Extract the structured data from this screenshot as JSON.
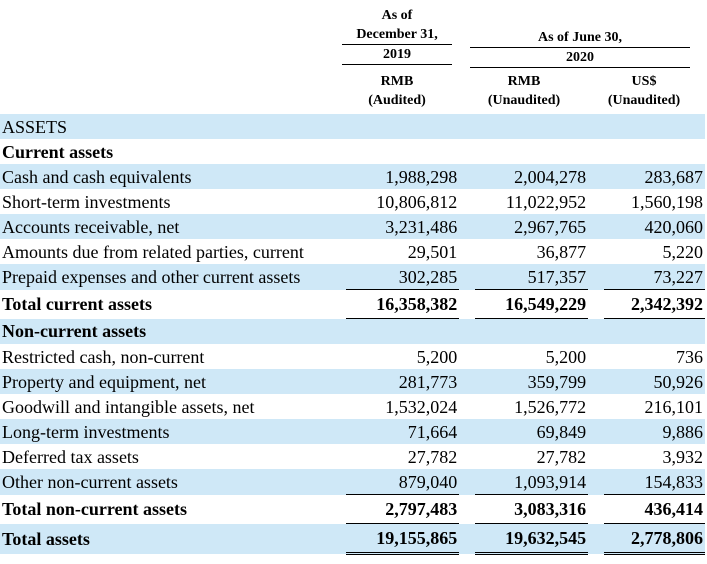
{
  "header": {
    "dec_line1": "As of",
    "dec_line2": "December 31,",
    "dec_year": "2019",
    "jun_label": "As of June 30,",
    "jun_year": "2020",
    "col1_currency": "RMB",
    "col1_status": "(Audited)",
    "col2_currency": "RMB",
    "col2_status": "(Unaudited)",
    "col3_currency": "US$",
    "col3_status": "(Unaudited)"
  },
  "rows": [
    {
      "label": "ASSETS",
      "v1": "",
      "v2": "",
      "v3": ""
    },
    {
      "label": "Current assets",
      "v1": "",
      "v2": "",
      "v3": ""
    },
    {
      "label": "Cash and cash equivalents",
      "v1": "1,988,298",
      "v2": "2,004,278",
      "v3": "283,687"
    },
    {
      "label": "Short-term investments",
      "v1": "10,806,812",
      "v2": "11,022,952",
      "v3": "1,560,198"
    },
    {
      "label": "Accounts receivable, net",
      "v1": "3,231,486",
      "v2": "2,967,765",
      "v3": "420,060"
    },
    {
      "label": "Amounts due from related parties, current",
      "v1": "29,501",
      "v2": "36,877",
      "v3": "5,220"
    },
    {
      "label": "Prepaid expenses and other current assets",
      "v1": "302,285",
      "v2": "517,357",
      "v3": "73,227"
    },
    {
      "label": "Total current assets",
      "v1": "16,358,382",
      "v2": "16,549,229",
      "v3": "2,342,392"
    },
    {
      "label": "Non-current assets",
      "v1": "",
      "v2": "",
      "v3": ""
    },
    {
      "label": "Restricted cash, non-current",
      "v1": "5,200",
      "v2": "5,200",
      "v3": "736"
    },
    {
      "label": "Property and equipment, net",
      "v1": "281,773",
      "v2": "359,799",
      "v3": "50,926"
    },
    {
      "label": "Goodwill and intangible assets, net",
      "v1": "1,532,024",
      "v2": "1,526,772",
      "v3": "216,101"
    },
    {
      "label": "Long-term investments",
      "v1": "71,664",
      "v2": "69,849",
      "v3": "9,886"
    },
    {
      "label": "Deferred tax assets",
      "v1": "27,782",
      "v2": "27,782",
      "v3": "3,932"
    },
    {
      "label": "Other non-current assets",
      "v1": "879,040",
      "v2": "1,093,914",
      "v3": "154,833"
    },
    {
      "label": "Total non-current assets",
      "v1": "2,797,483",
      "v2": "3,083,316",
      "v3": "436,414"
    },
    {
      "label": "Total assets",
      "v1": "19,155,865",
      "v2": "19,632,545",
      "v3": "2,778,806"
    }
  ]
}
